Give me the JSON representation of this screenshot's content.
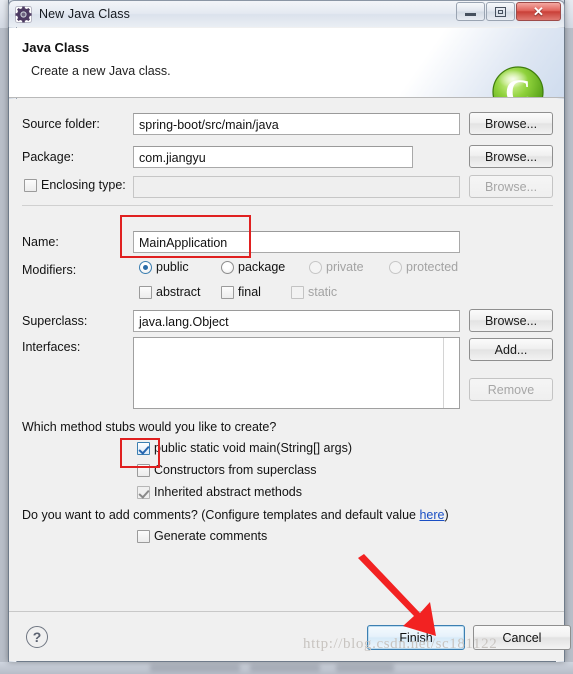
{
  "window": {
    "title": "New Java Class",
    "icon": "eclipse-gear-icon",
    "buttons": {
      "minimize": "–",
      "restore": "□",
      "close": "✕"
    }
  },
  "header": {
    "title": "Java Class",
    "subtitle": "Create a new Java class.",
    "icon": "green-c-icon"
  },
  "form": {
    "source_folder": {
      "label": "Source folder:",
      "value": "spring-boot/src/main/java",
      "button": "Browse..."
    },
    "package": {
      "label": "Package:",
      "value": "com.jiangyu",
      "button": "Browse..."
    },
    "enclosing_type": {
      "label": "Enclosing type:",
      "checked": false,
      "value": "",
      "button": "Browse...",
      "disabled": true
    },
    "name": {
      "label": "Name:",
      "value": "MainApplication"
    },
    "modifiers": {
      "label": "Modifiers:",
      "radios": [
        {
          "label": "public",
          "selected": true,
          "disabled": false
        },
        {
          "label": "package",
          "selected": false,
          "disabled": false
        },
        {
          "label": "private",
          "selected": false,
          "disabled": true
        },
        {
          "label": "protected",
          "selected": false,
          "disabled": true
        }
      ],
      "checkboxes": [
        {
          "label": "abstract",
          "checked": false,
          "disabled": false
        },
        {
          "label": "final",
          "checked": false,
          "disabled": false
        },
        {
          "label": "static",
          "checked": false,
          "disabled": true
        }
      ]
    },
    "superclass": {
      "label": "Superclass:",
      "value": "java.lang.Object",
      "button": "Browse..."
    },
    "interfaces": {
      "label": "Interfaces:",
      "items": [],
      "add_button": "Add...",
      "remove_button": "Remove",
      "remove_disabled": true
    }
  },
  "stubs": {
    "question": "Which method stubs would you like to create?",
    "options": [
      {
        "label": "public static void main(String[] args)",
        "checked": true,
        "disabled": false
      },
      {
        "label": "Constructors from superclass",
        "checked": false,
        "disabled": false
      },
      {
        "label": "Inherited abstract methods",
        "checked": true,
        "disabled": true
      }
    ]
  },
  "comments": {
    "question_prefix": "Do you want to add comments? (Configure templates and default value ",
    "link": "here",
    "question_suffix": ")",
    "checkbox": {
      "label": "Generate comments",
      "checked": false
    }
  },
  "footer": {
    "help_icon": "?",
    "finish_button": "Finish",
    "cancel_button": "Cancel"
  },
  "annotations": {
    "watermark": "http://blog.csdn.net/sc181122",
    "highlight_color": "#e02020",
    "arrow_color": "#f22222"
  }
}
